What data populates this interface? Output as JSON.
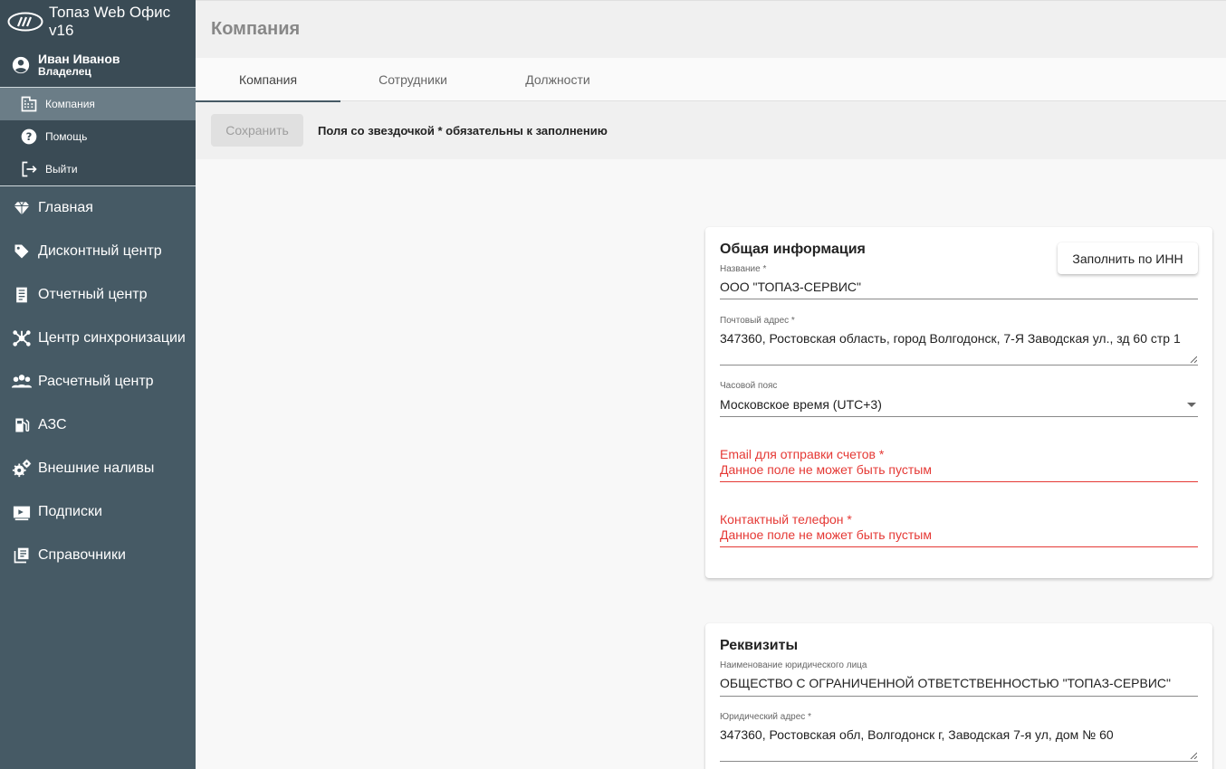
{
  "app": {
    "title": "Топаз Web Офис v16"
  },
  "user": {
    "name": "Иван Иванов",
    "role": "Владелец"
  },
  "sub_menu": [
    {
      "label": "Компания",
      "icon": "building-icon",
      "active": true
    },
    {
      "label": "Помощь",
      "icon": "help-icon",
      "active": false
    },
    {
      "label": "Выйти",
      "icon": "logout-icon",
      "active": false
    }
  ],
  "nav": [
    {
      "label": "Главная",
      "icon": "diamond-icon"
    },
    {
      "label": "Дисконтный центр",
      "icon": "tag-icon"
    },
    {
      "label": "Отчетный центр",
      "icon": "report-icon"
    },
    {
      "label": "Центр синхронизации",
      "icon": "sync-hub-icon"
    },
    {
      "label": "Расчетный центр",
      "icon": "people-icon"
    },
    {
      "label": "АЗС",
      "icon": "fuel-icon"
    },
    {
      "label": "Внешние наливы",
      "icon": "gears-icon"
    },
    {
      "label": "Подписки",
      "icon": "subscription-icon"
    },
    {
      "label": "Справочники",
      "icon": "library-icon"
    }
  ],
  "page": {
    "title": "Компания"
  },
  "tabs": [
    {
      "label": "Компания",
      "active": true
    },
    {
      "label": "Сотрудники",
      "active": false
    },
    {
      "label": "Должности",
      "active": false
    }
  ],
  "toolbar": {
    "save_label": "Сохранить",
    "note": "Поля со звездочкой * обязательны к заполнению"
  },
  "general": {
    "title": "Общая информация",
    "fill_inn_label": "Заполнить по ИНН",
    "name_label": "Название *",
    "name_value": "ООО \"ТОПАЗ-СЕРВИС\"",
    "postal_label": "Почтовый адрес *",
    "postal_value": "347360, Ростовская область, город Волгодонск, 7-Я Заводская ул., зд 60 стр 1",
    "tz_label": "Часовой пояс",
    "tz_value": "Московское время (UTC+3)",
    "email_label": "Email для отправки счетов *",
    "email_error": "Данное поле не может быть пустым",
    "phone_label": "Контактный телефон *",
    "phone_error": "Данное поле не может быть пустым"
  },
  "requisites": {
    "title": "Реквизиты",
    "legal_name_label": "Наименование юридического лица",
    "legal_name_value": "ОБЩЕСТВО С ОГРАНИЧЕННОЙ ОТВЕТСТВЕННОСТЬЮ \"ТОПАЗ-СЕРВИС\"",
    "legal_addr_label": "Юридический адрес *",
    "legal_addr_value": "347360, Ростовская обл, Волгодонск г, Заводская 7-я ул, дом № 60"
  },
  "colors": {
    "sidebar": "#465a65",
    "sidebar_dark": "#3a4b55",
    "error": "#e53935"
  }
}
